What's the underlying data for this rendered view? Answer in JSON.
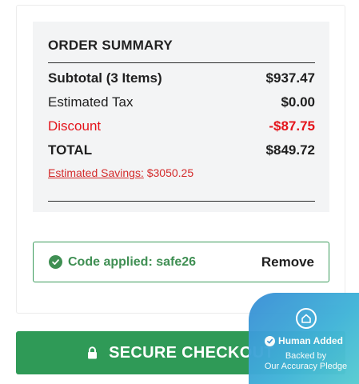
{
  "order_summary": {
    "title": "ORDER SUMMARY",
    "rows": [
      {
        "label": "Subtotal (3 Items)",
        "value": "$937.47"
      },
      {
        "label": "Estimated Tax",
        "value": "$0.00"
      },
      {
        "label": "Discount",
        "value": "-$87.75"
      },
      {
        "label": "TOTAL",
        "value": "$849.72"
      }
    ],
    "savings_link": "Estimated Savings:",
    "savings_value": "$3050.25"
  },
  "promo": {
    "applied_text": "Code applied: safe26",
    "remove_label": "Remove"
  },
  "checkout": {
    "label": "SECURE CHECKOUT"
  },
  "badge": {
    "title": "Human Added",
    "line1": "Backed by",
    "line2": "Our Accuracy Pledge"
  },
  "colors": {
    "accent_green": "#2f9a57",
    "discount_red": "#e4141b",
    "badge_blue": "#3b8fd6"
  },
  "icons": {
    "promo": "check-circle-icon",
    "checkout": "lock-icon",
    "badge_logo": "shield-house-icon",
    "badge_check": "check-badge-icon"
  }
}
